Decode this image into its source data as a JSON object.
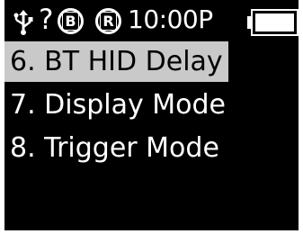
{
  "status": {
    "unknown_symbol": "?",
    "badge_b": "B",
    "badge_r": "R",
    "time": "10:00P",
    "battery_level": 1.0
  },
  "menu": {
    "items": [
      {
        "label": "6. BT HID Delay",
        "selected": true
      },
      {
        "label": "7. Display Mode",
        "selected": false
      },
      {
        "label": "8. Trigger Mode",
        "selected": false
      }
    ]
  },
  "colors": {
    "screen_bg": "#000000",
    "text": "#ffffff",
    "highlight": "#c9c9c9"
  }
}
